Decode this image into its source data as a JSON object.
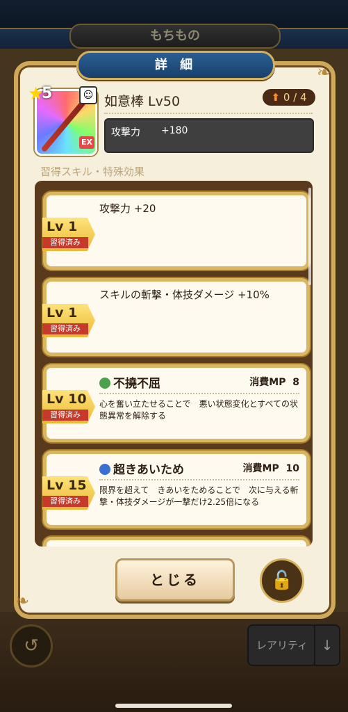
{
  "screen_title": "もちもの",
  "modal": {
    "title": "詳 細",
    "rarity": "5",
    "ex_badge": "EX",
    "item_name": "如意棒 Lv50",
    "upgrade": "0 / 4",
    "stat_label": "攻撃力",
    "stat_value": "+180",
    "section_label": "習得スキル・特殊効果"
  },
  "cards": [
    {
      "lv": "Lv 1",
      "learned": "習得済み",
      "text": "攻撃力 +20"
    },
    {
      "lv": "Lv 1",
      "learned": "習得済み",
      "text": "スキルの斬撃・体技ダメージ +10%"
    },
    {
      "lv": "Lv 10",
      "learned": "習得済み",
      "skill": "不撓不屈",
      "mp_label": "消費MP",
      "mp": "8",
      "desc": "心を奮い立たせることで　悪い状態変化とすべての状態異常を解除する",
      "icon_color": "#4aa34a"
    },
    {
      "lv": "Lv 15",
      "learned": "習得済み",
      "skill": "超きあいため",
      "mp_label": "消費MP",
      "mp": "10",
      "desc": "限界を超えて　きあいをためることで　次に与える斬撃・体技ダメージが一撃だけ2.25倍になる",
      "icon_color": "#3a6fd4"
    }
  ],
  "buttons": {
    "close": "とじる",
    "rarity": "レアリティ"
  }
}
